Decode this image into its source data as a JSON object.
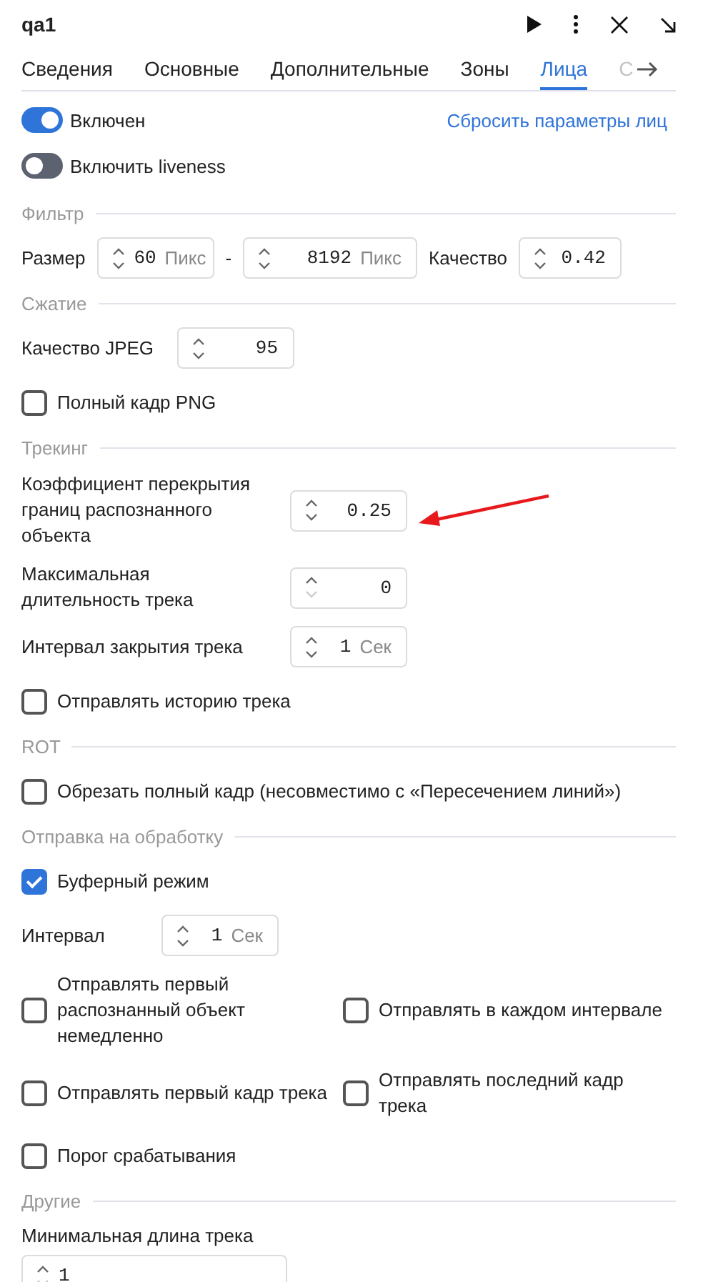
{
  "window": {
    "title": "qa1"
  },
  "tabs": [
    {
      "label": "Сведения",
      "selected": false
    },
    {
      "label": "Основные",
      "selected": false
    },
    {
      "label": "Дополнительные",
      "selected": false
    },
    {
      "label": "Зоны",
      "selected": false
    },
    {
      "label": "Лица",
      "selected": true
    },
    {
      "label": "С",
      "selected": false
    }
  ],
  "toggles": [
    {
      "label": "Включен",
      "on": true
    },
    {
      "label": "Включить liveness",
      "on": false
    }
  ],
  "reset_link": "Сбросить параметры лиц",
  "sections": [
    {
      "title": "Фильтр",
      "rows": [
        {
          "kind": "inline",
          "items": [
            {
              "kind": "label",
              "text": "Размер"
            },
            {
              "kind": "spin",
              "value": "60",
              "unit": "Пикс"
            },
            {
              "kind": "label",
              "text": "-"
            },
            {
              "kind": "spin",
              "value": "8192",
              "unit": "Пикс"
            },
            {
              "kind": "label",
              "text": "Качество"
            },
            {
              "kind": "spin",
              "value": "0.42"
            }
          ]
        }
      ]
    },
    {
      "title": "Сжатие",
      "rows": [
        {
          "kind": "field",
          "label": "Качество JPEG",
          "value": "95"
        },
        {
          "kind": "check",
          "label": "Полный кадр PNG",
          "checked": false
        }
      ]
    },
    {
      "title": "Трекинг",
      "rows": [
        {
          "kind": "field",
          "label": "Коэффициент перекрытия границ распознанного объекта",
          "value": "0.25",
          "highlighted": true
        },
        {
          "kind": "field",
          "label": "Максимальная длительность трека",
          "value": "0",
          "down_disabled": true
        },
        {
          "kind": "field",
          "label": "Интервал закрытия трека",
          "value": "1",
          "unit": "Сек"
        },
        {
          "kind": "check",
          "label": "Отправлять историю трека",
          "checked": false
        }
      ]
    },
    {
      "title": "ROT",
      "rows": [
        {
          "kind": "check",
          "label": "Обрезать полный кадр (несовместимо с «Пересечением линий»)",
          "checked": false
        }
      ]
    },
    {
      "title": "Отправка на обработку",
      "rows": [
        {
          "kind": "check",
          "label": "Буферный режим",
          "checked": true
        },
        {
          "kind": "field",
          "label": "Интервал",
          "value": "1",
          "unit": "Сек"
        },
        {
          "kind": "check_pair",
          "items": [
            {
              "label": "Отправлять первый распознанный объект немедленно",
              "checked": false
            },
            {
              "label": "Отправлять в каждом интервале",
              "checked": false
            }
          ]
        },
        {
          "kind": "check_pair",
          "items": [
            {
              "label": "Отправлять первый кадр трека",
              "checked": false
            },
            {
              "label": "Отправлять последний кадр трека",
              "checked": false
            }
          ]
        },
        {
          "kind": "check",
          "label": "Порог срабатывания",
          "checked": false
        }
      ]
    },
    {
      "title": "Другие",
      "rows": [
        {
          "kind": "field_below",
          "label": "Минимальная длина трека",
          "value": "1",
          "down_disabled": true
        }
      ]
    }
  ]
}
